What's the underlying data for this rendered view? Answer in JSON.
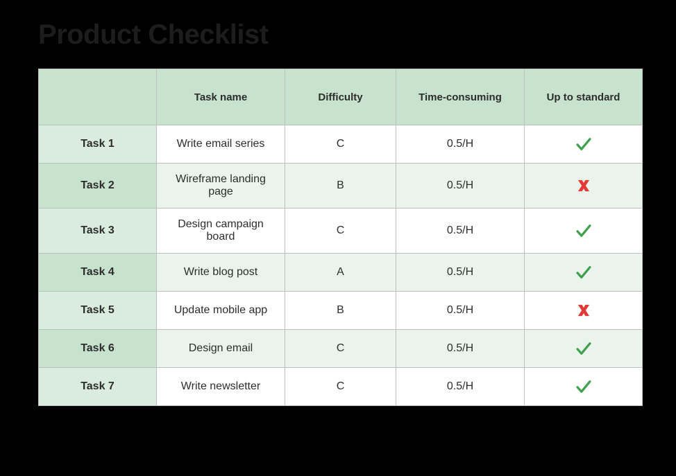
{
  "title": "Product Checklist",
  "headers": {
    "blank": "",
    "task_name": "Task name",
    "difficulty": "Difficulty",
    "time": "Time-consuming",
    "standard": "Up to standard"
  },
  "rows": [
    {
      "label": "Task 1",
      "name": "Write email series",
      "difficulty": "C",
      "time": "0.5/H",
      "standard": true
    },
    {
      "label": "Task 2",
      "name": "Wireframe landing page",
      "difficulty": "B",
      "time": "0.5/H",
      "standard": false
    },
    {
      "label": "Task 3",
      "name": "Design campaign board",
      "difficulty": "C",
      "time": "0.5/H",
      "standard": true
    },
    {
      "label": "Task 4",
      "name": "Write blog post",
      "difficulty": "A",
      "time": "0.5/H",
      "standard": true
    },
    {
      "label": "Task 5",
      "name": "Update mobile app",
      "difficulty": "B",
      "time": "0.5/H",
      "standard": false
    },
    {
      "label": "Task 6",
      "name": "Design email",
      "difficulty": "C",
      "time": "0.5/H",
      "standard": true
    },
    {
      "label": "Task 7",
      "name": "Write newsletter",
      "difficulty": "C",
      "time": "0.5/H",
      "standard": true
    }
  ],
  "icons": {
    "check_name": "check-icon",
    "cross_name": "cross-icon"
  },
  "chart_data": {
    "type": "table",
    "title": "Product Checklist",
    "columns": [
      "Task",
      "Task name",
      "Difficulty",
      "Time-consuming",
      "Up to standard"
    ],
    "rows": [
      [
        "Task 1",
        "Write email series",
        "C",
        "0.5/H",
        "yes"
      ],
      [
        "Task 2",
        "Wireframe landing page",
        "B",
        "0.5/H",
        "no"
      ],
      [
        "Task 3",
        "Design campaign board",
        "C",
        "0.5/H",
        "yes"
      ],
      [
        "Task 4",
        "Write blog post",
        "A",
        "0.5/H",
        "yes"
      ],
      [
        "Task 5",
        "Update mobile app",
        "B",
        "0.5/H",
        "no"
      ],
      [
        "Task 6",
        "Design email",
        "C",
        "0.5/H",
        "yes"
      ],
      [
        "Task 7",
        "Write newsletter",
        "C",
        "0.5/H",
        "yes"
      ]
    ]
  }
}
